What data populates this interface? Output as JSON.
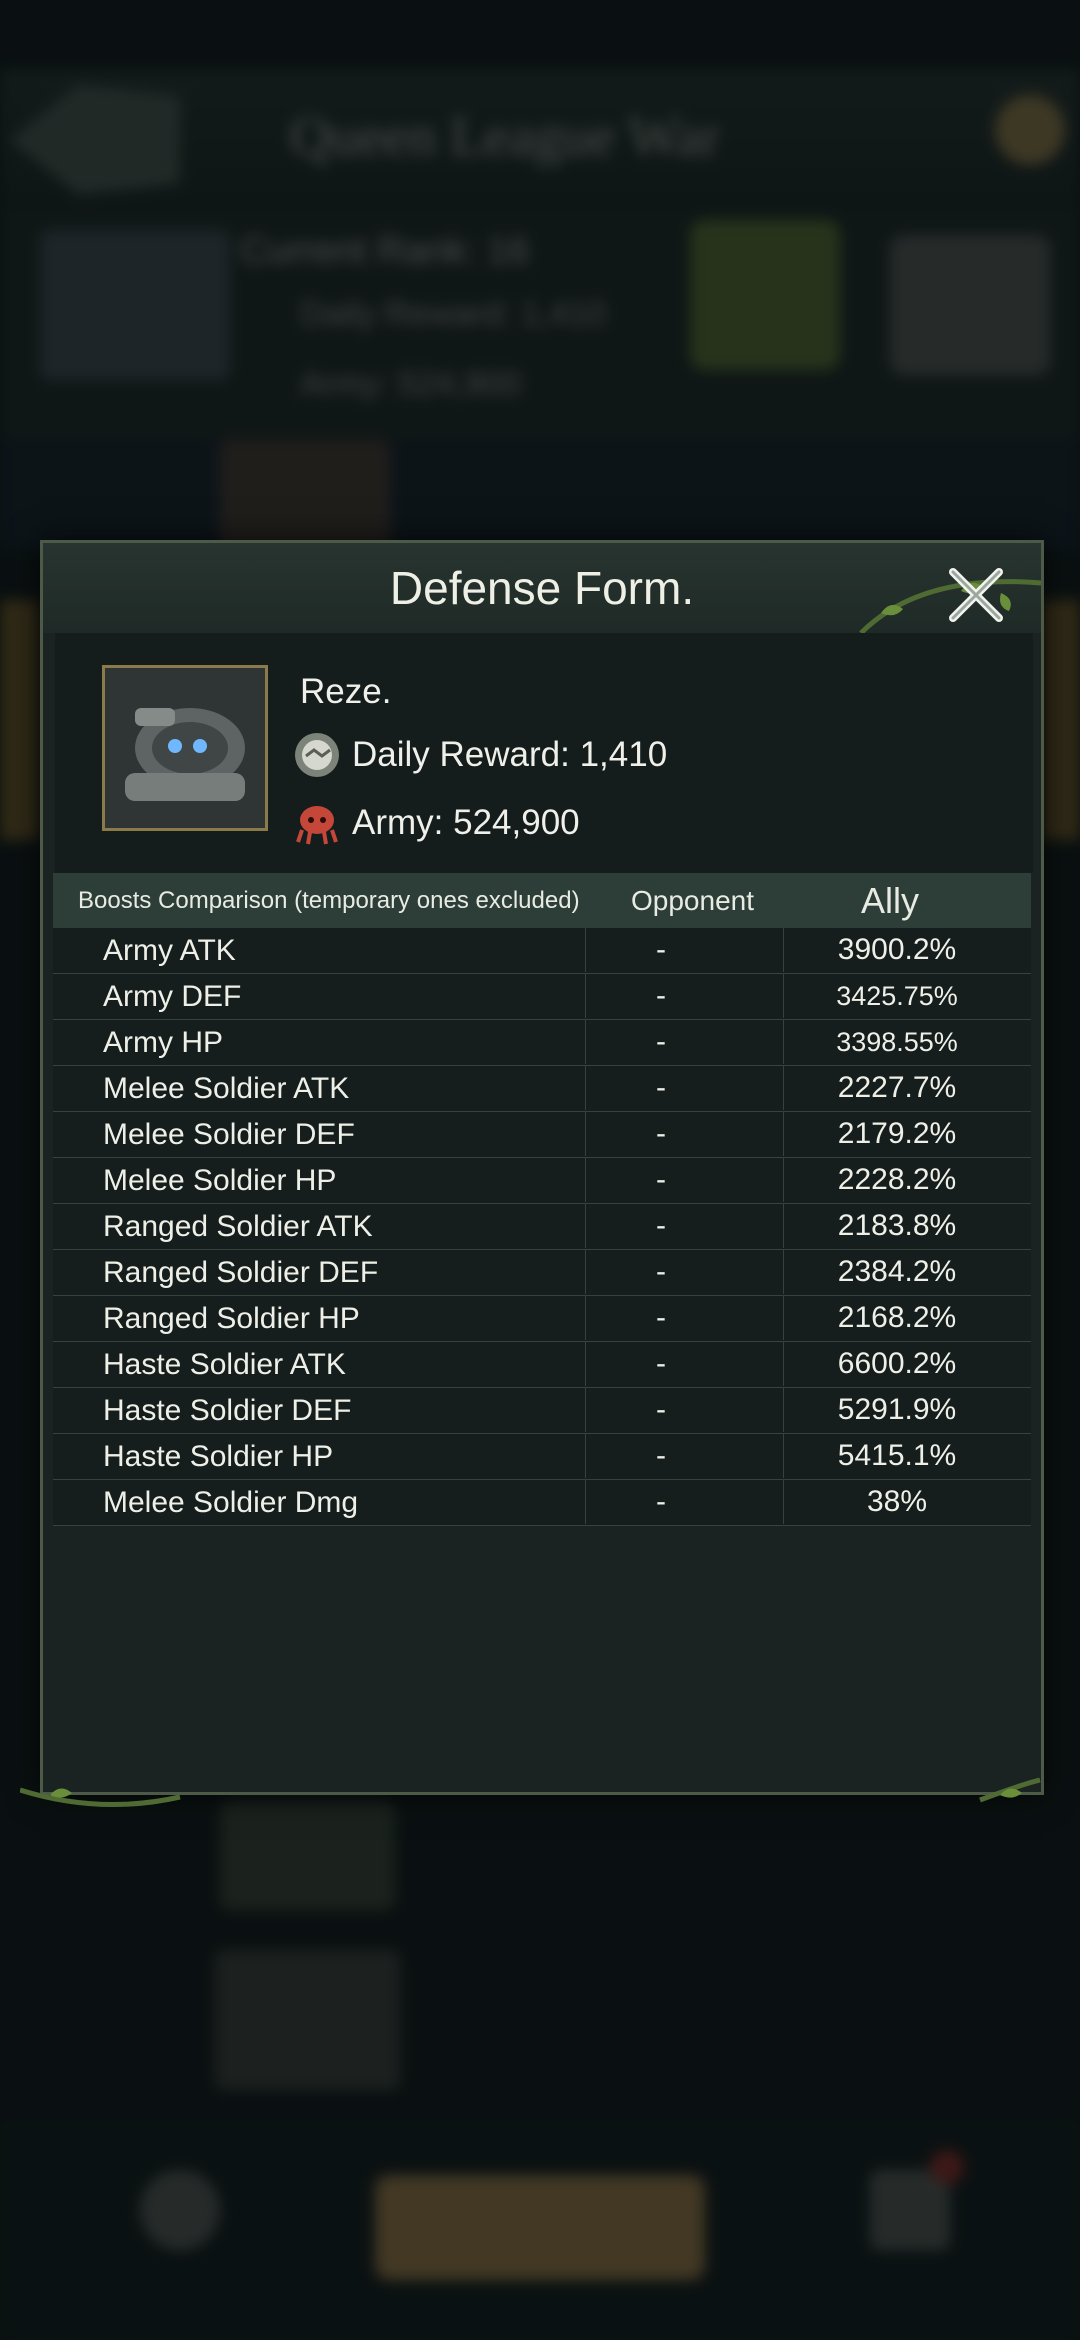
{
  "background": {
    "title": "Queen League War",
    "rank": "Current Rank: 16",
    "daily": "Daily Reward: 1,410",
    "army": "Army: 524,900"
  },
  "modal": {
    "title": "Defense Form.",
    "player": {
      "name": "Reze.",
      "daily_reward": "Daily Reward: 1,410",
      "army": "Army: 524,900"
    },
    "table": {
      "header": {
        "boosts": "Boosts Comparison (temporary ones excluded)",
        "opponent": "Opponent",
        "ally": "Ally"
      },
      "rows": [
        {
          "stat": "Army ATK",
          "opponent": "-",
          "ally": "3900.2%"
        },
        {
          "stat": "Army DEF",
          "opponent": "-",
          "ally": "3425.75%"
        },
        {
          "stat": "Army HP",
          "opponent": "-",
          "ally": "3398.55%"
        },
        {
          "stat": "Melee Soldier ATK",
          "opponent": "-",
          "ally": "2227.7%"
        },
        {
          "stat": "Melee Soldier DEF",
          "opponent": "-",
          "ally": "2179.2%"
        },
        {
          "stat": "Melee Soldier HP",
          "opponent": "-",
          "ally": "2228.2%"
        },
        {
          "stat": "Ranged Soldier ATK",
          "opponent": "-",
          "ally": "2183.8%"
        },
        {
          "stat": "Ranged Soldier DEF",
          "opponent": "-",
          "ally": "2384.2%"
        },
        {
          "stat": "Ranged Soldier HP",
          "opponent": "-",
          "ally": "2168.2%"
        },
        {
          "stat": "Haste Soldier ATK",
          "opponent": "-",
          "ally": "6600.2%"
        },
        {
          "stat": "Haste Soldier DEF",
          "opponent": "-",
          "ally": "5291.9%"
        },
        {
          "stat": "Haste Soldier HP",
          "opponent": "-",
          "ally": "5415.1%"
        },
        {
          "stat": "Melee Soldier Dmg",
          "opponent": "-",
          "ally": "38%"
        }
      ]
    }
  },
  "icons": {
    "close": "close-icon",
    "daily": "coin-icon",
    "army": "army-icon"
  }
}
